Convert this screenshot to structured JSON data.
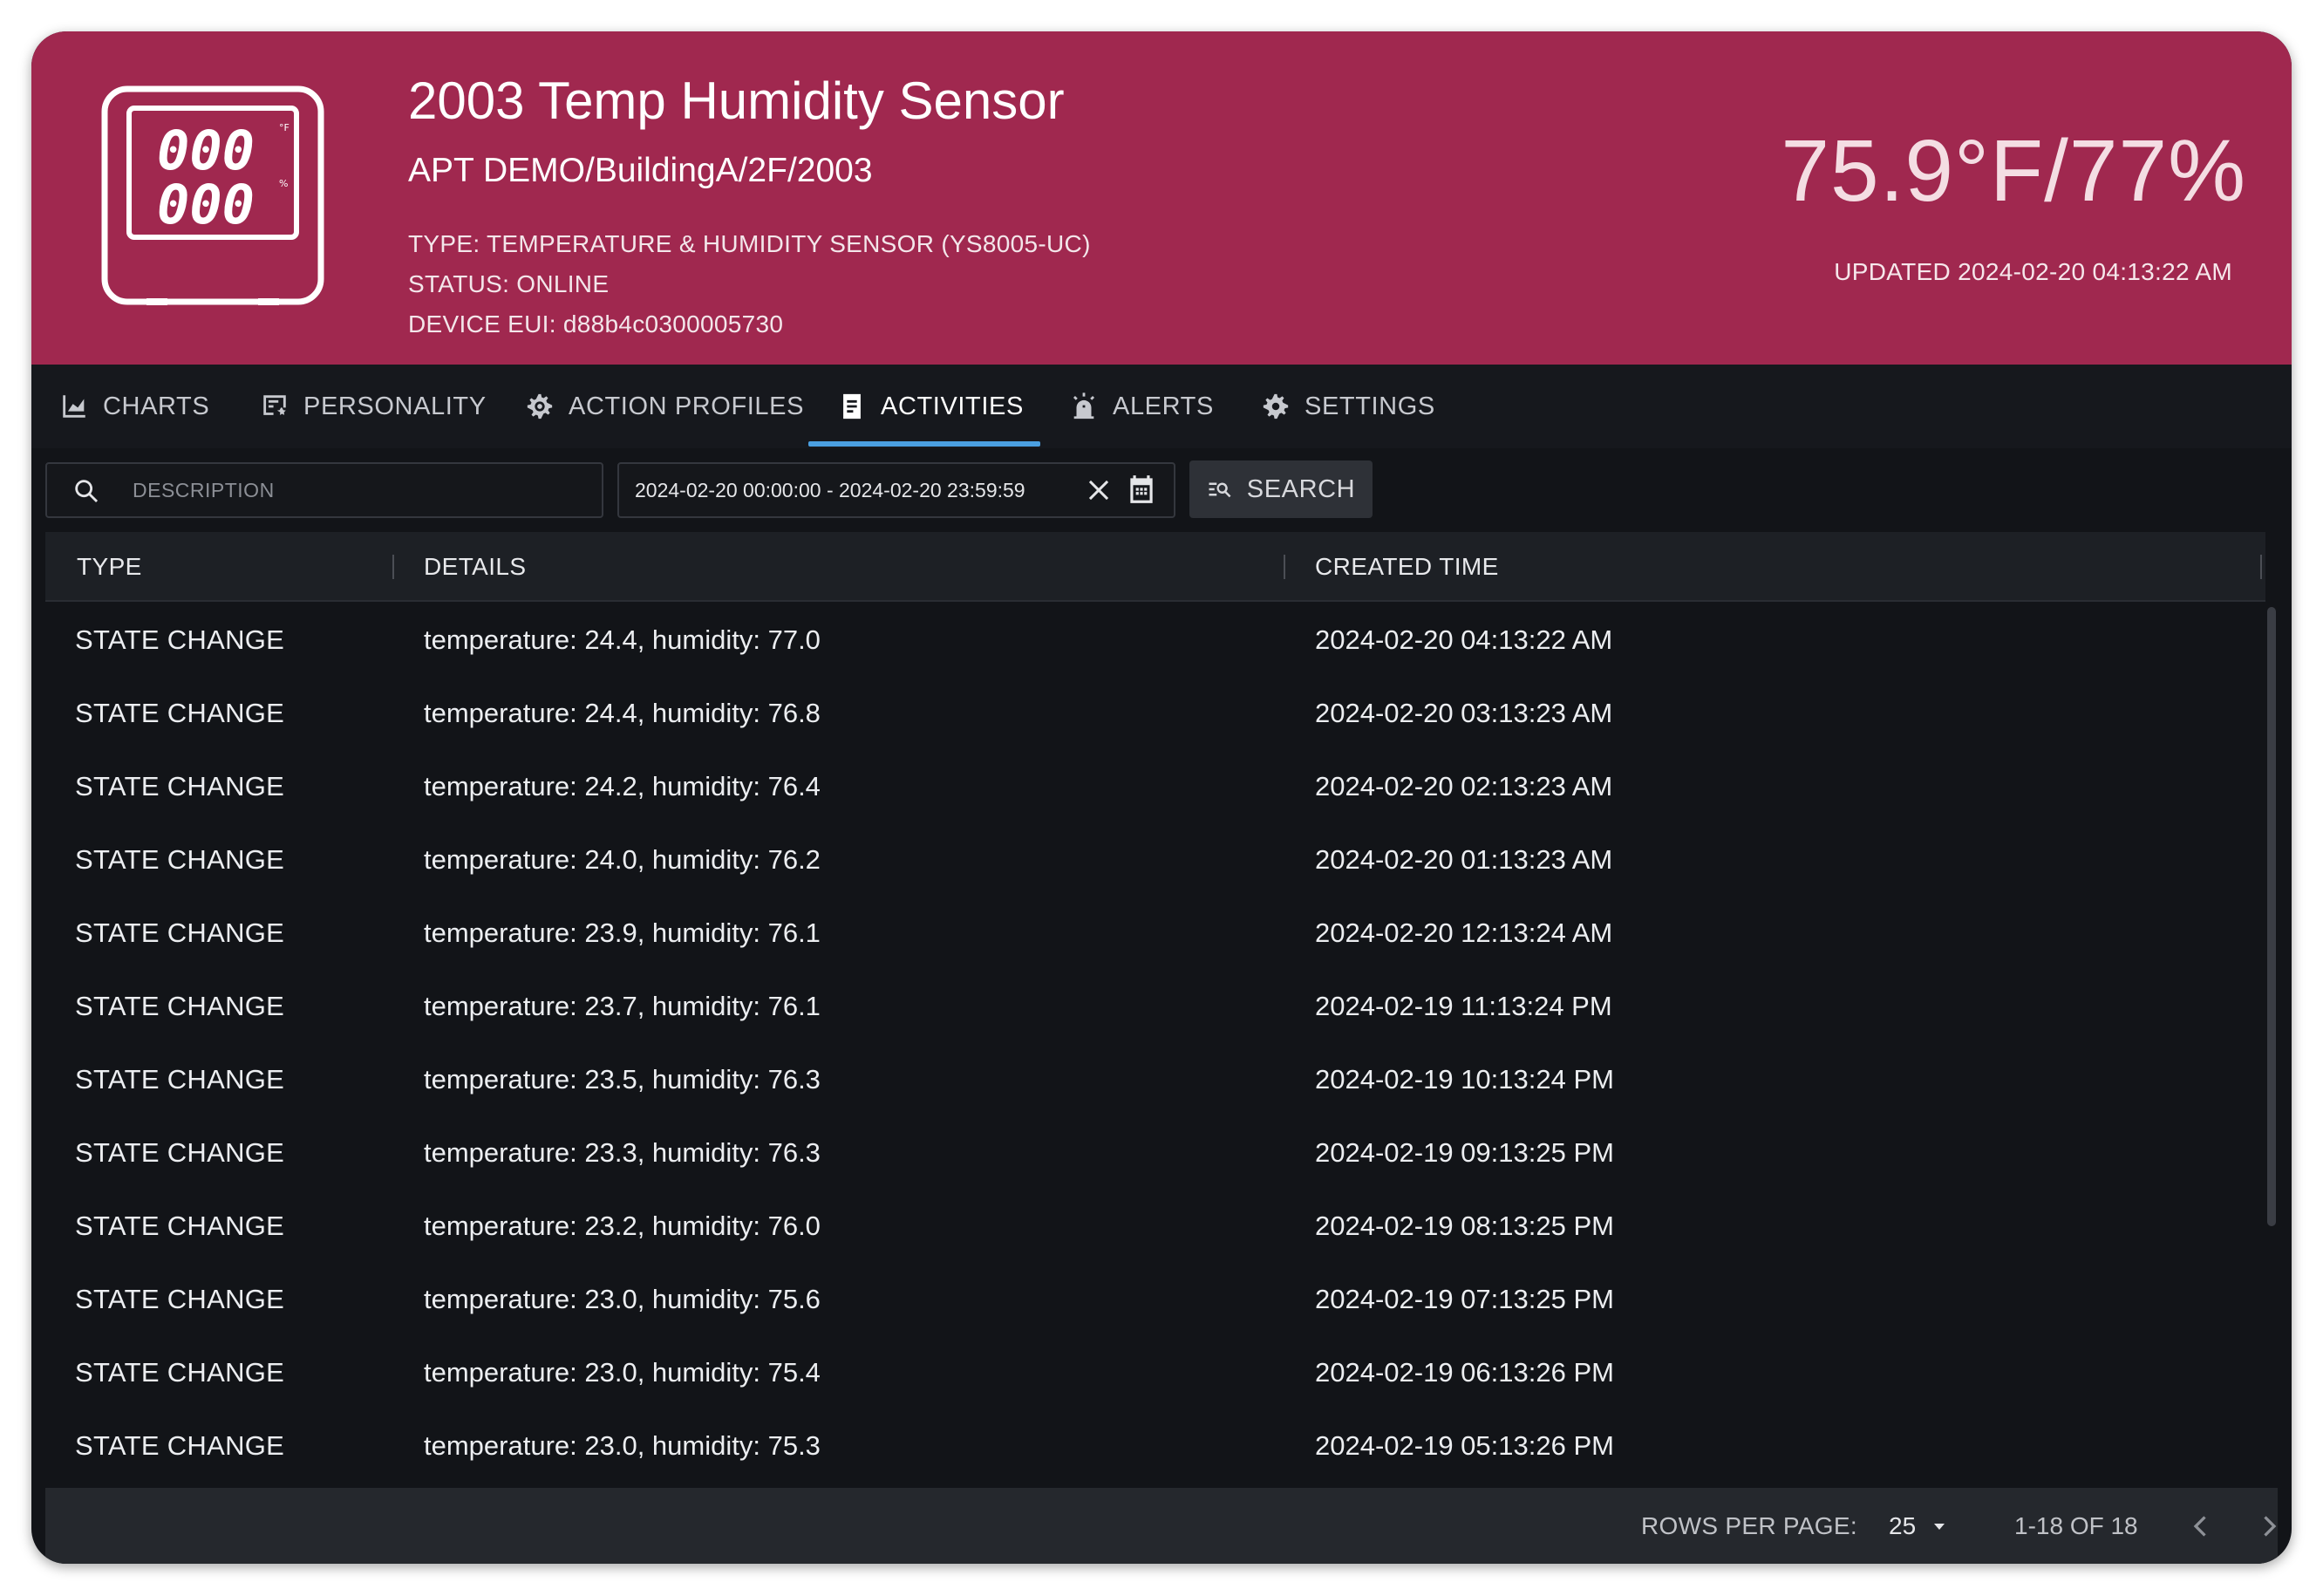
{
  "header": {
    "title": "2003 Temp Humidity Sensor",
    "subtitle": "APT DEMO/BuildingA/2F/2003",
    "type_line": "TYPE:  TEMPERATURE & HUMIDITY SENSOR (YS8005-UC)",
    "status_line": "STATUS:  ONLINE",
    "eui_line": "DEVICE EUI: d88b4c0300005730",
    "reading": "75.9°F/77%",
    "updated": "UPDATED 2024-02-20 04:13:22 AM",
    "lcd_top": "000",
    "lcd_bottom": "000",
    "lcd_unit_top": "°F",
    "lcd_unit_bottom": "%",
    "accent_color": "#a0284f"
  },
  "tabs": [
    {
      "label": "CHARTS",
      "icon": "chart-icon"
    },
    {
      "label": "PERSONALITY",
      "icon": "personality-icon"
    },
    {
      "label": "ACTION PROFILES",
      "icon": "gear-outline-icon"
    },
    {
      "label": "ACTIVITIES",
      "icon": "document-icon",
      "active": true
    },
    {
      "label": "ALERTS",
      "icon": "siren-icon"
    },
    {
      "label": "SETTINGS",
      "icon": "gear-icon"
    }
  ],
  "toolbar": {
    "search_placeholder": "DESCRIPTION",
    "date_range": "2024-02-20 00:00:00 - 2024-02-20 23:59:59",
    "search_button": "SEARCH"
  },
  "table": {
    "columns": [
      "TYPE",
      "DETAILS",
      "CREATED TIME"
    ],
    "rows": [
      {
        "type": "STATE CHANGE",
        "details": "temperature: 24.4, humidity: 77.0",
        "time": "2024-02-20 04:13:22 AM"
      },
      {
        "type": "STATE CHANGE",
        "details": "temperature: 24.4, humidity: 76.8",
        "time": "2024-02-20 03:13:23 AM"
      },
      {
        "type": "STATE CHANGE",
        "details": "temperature: 24.2, humidity: 76.4",
        "time": "2024-02-20 02:13:23 AM"
      },
      {
        "type": "STATE CHANGE",
        "details": "temperature: 24.0, humidity: 76.2",
        "time": "2024-02-20 01:13:23 AM"
      },
      {
        "type": "STATE CHANGE",
        "details": "temperature: 23.9, humidity: 76.1",
        "time": "2024-02-20 12:13:24 AM"
      },
      {
        "type": "STATE CHANGE",
        "details": "temperature: 23.7, humidity: 76.1",
        "time": "2024-02-19 11:13:24 PM"
      },
      {
        "type": "STATE CHANGE",
        "details": "temperature: 23.5, humidity: 76.3",
        "time": "2024-02-19 10:13:24 PM"
      },
      {
        "type": "STATE CHANGE",
        "details": "temperature: 23.3, humidity: 76.3",
        "time": "2024-02-19 09:13:25 PM"
      },
      {
        "type": "STATE CHANGE",
        "details": "temperature: 23.2, humidity: 76.0",
        "time": "2024-02-19 08:13:25 PM"
      },
      {
        "type": "STATE CHANGE",
        "details": "temperature: 23.0, humidity: 75.6",
        "time": "2024-02-19 07:13:25 PM"
      },
      {
        "type": "STATE CHANGE",
        "details": "temperature: 23.0, humidity: 75.4",
        "time": "2024-02-19 06:13:26 PM"
      },
      {
        "type": "STATE CHANGE",
        "details": "temperature: 23.0, humidity: 75.3",
        "time": "2024-02-19 05:13:26 PM"
      }
    ]
  },
  "footer": {
    "rows_per_page_label": "ROWS PER PAGE:",
    "rows_per_page_value": "25",
    "range": "1-18 OF 18"
  }
}
